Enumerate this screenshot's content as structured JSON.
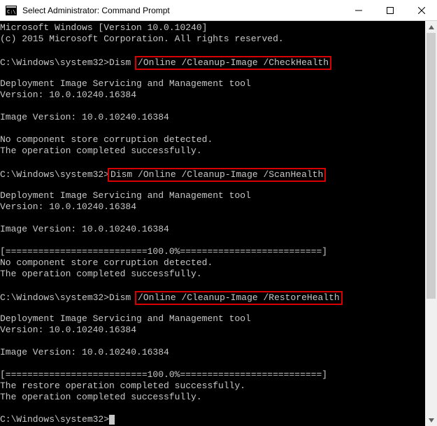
{
  "window": {
    "title": "Select Administrator: Command Prompt",
    "icon_name": "cmd-icon"
  },
  "terminal": {
    "header": [
      "Microsoft Windows [Version 10.0.10240]",
      "(c) 2015 Microsoft Corporation. All rights reserved."
    ],
    "commands": [
      {
        "prompt": "C:\\Windows\\system32>",
        "cmd_pre": "Dism ",
        "cmd_hl": "/Online /Cleanup-Image /CheckHealth",
        "output": [
          "",
          "Deployment Image Servicing and Management tool",
          "Version: 10.0.10240.16384",
          "",
          "Image Version: 10.0.10240.16384",
          "",
          "No component store corruption detected.",
          "The operation completed successfully."
        ]
      },
      {
        "prompt": "C:\\Windows\\system32>",
        "cmd_pre": "",
        "cmd_hl": "Dism /Online /Cleanup-Image /ScanHealth",
        "output": [
          "",
          "Deployment Image Servicing and Management tool",
          "Version: 10.0.10240.16384",
          "",
          "Image Version: 10.0.10240.16384",
          "",
          "[==========================100.0%==========================]",
          "No component store corruption detected.",
          "The operation completed successfully."
        ]
      },
      {
        "prompt": "C:\\Windows\\system32>",
        "cmd_pre": "Dism ",
        "cmd_hl": "/Online /Cleanup-Image /RestoreHealth",
        "output": [
          "",
          "Deployment Image Servicing and Management tool",
          "Version: 10.0.10240.16384",
          "",
          "Image Version: 10.0.10240.16384",
          "",
          "[==========================100.0%==========================]",
          "The restore operation completed successfully.",
          "The operation completed successfully."
        ]
      }
    ],
    "final_prompt": "C:\\Windows\\system32>"
  }
}
